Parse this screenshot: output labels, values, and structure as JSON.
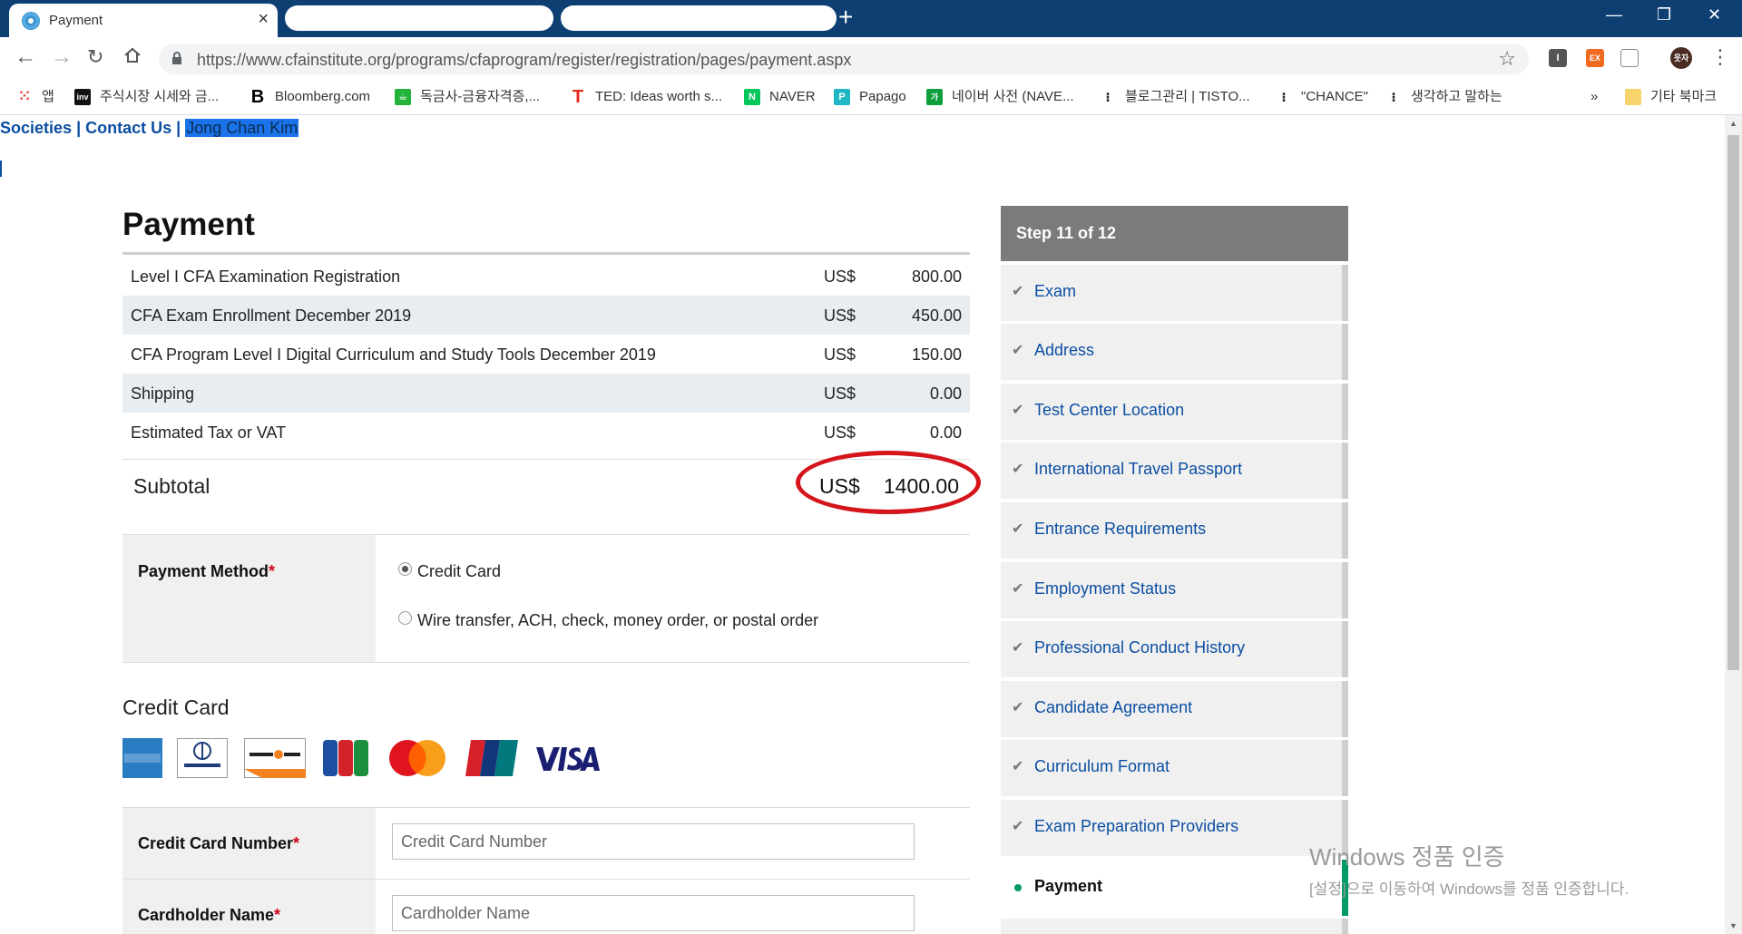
{
  "browser": {
    "tab_title": "Payment",
    "tab_close": "×",
    "new_tab": "+",
    "window_controls": {
      "minimize": "—",
      "restore": "❐",
      "close": "✕"
    },
    "url": "https://www.cfainstitute.org/programs/cfaprogram/register/registration/pages/payment.aspx",
    "profile_label": "웃자"
  },
  "bookmarks": {
    "items": [
      {
        "label": "앱",
        "icon": "apps-grid-icon"
      },
      {
        "label": "주식시장 시세와 금...",
        "icon": "investing-icon"
      },
      {
        "label": "Bloomberg.com",
        "icon": "bloomberg-icon"
      },
      {
        "label": "독금사-금융자격증,...",
        "icon": "naver-cafe-icon"
      },
      {
        "label": "TED: Ideas worth s...",
        "icon": "ted-icon"
      },
      {
        "label": "NAVER",
        "icon": "naver-icon"
      },
      {
        "label": "Papago",
        "icon": "papago-icon"
      },
      {
        "label": "네이버 사전 (NAVE...",
        "icon": "naver-dictionary-icon"
      },
      {
        "label": "블로그관리 | TISTO...",
        "icon": "tistory-icon"
      },
      {
        "label": "\"CHANCE\"",
        "icon": "tistory-icon"
      },
      {
        "label": "생각하고 말하는",
        "icon": "tistory-icon"
      }
    ],
    "overflow": "»",
    "other_bookmarks": "기타 북마크"
  },
  "topnav": {
    "societies": "Societies",
    "separator": "|",
    "contact": "Contact Us",
    "user": "Jong Chan Kim"
  },
  "payment": {
    "title": "Payment",
    "fees": [
      {
        "description": "Level I CFA Examination Registration",
        "currency": "US$",
        "amount": "800.00"
      },
      {
        "description": "CFA Exam Enrollment December 2019",
        "currency": "US$",
        "amount": "450.00"
      },
      {
        "description": "CFA Program Level I Digital Curriculum and Study Tools December 2019",
        "currency": "US$",
        "amount": "150.00"
      },
      {
        "description": "Shipping",
        "currency": "US$",
        "amount": "0.00"
      },
      {
        "description": "Estimated Tax or VAT",
        "currency": "US$",
        "amount": "0.00"
      }
    ],
    "subtotal": {
      "label": "Subtotal",
      "currency": "US$",
      "amount": "1400.00"
    },
    "method": {
      "label": "Payment Method",
      "required_mark": "*",
      "options": [
        {
          "label": "Credit Card",
          "selected": true
        },
        {
          "label": "Wire transfer, ACH, check, money order, or postal order",
          "selected": false
        }
      ]
    },
    "credit_card": {
      "heading": "Credit Card",
      "brands": [
        "AMERICAN EXPRESS",
        "Diners Club",
        "DISCOVER",
        "JCB",
        "MasterCard",
        "UnionPay",
        "VISA"
      ],
      "number_label": "Credit Card Number",
      "number_placeholder": "Credit Card Number",
      "name_label": "Cardholder Name",
      "name_placeholder": "Cardholder Name"
    }
  },
  "steps": {
    "header": "Step 11 of 12",
    "items": [
      {
        "label": "Exam",
        "status": "done"
      },
      {
        "label": "Address",
        "status": "done"
      },
      {
        "label": "Test Center Location",
        "status": "done"
      },
      {
        "label": "International Travel Passport",
        "status": "done"
      },
      {
        "label": "Entrance Requirements",
        "status": "done"
      },
      {
        "label": "Employment Status",
        "status": "done"
      },
      {
        "label": "Professional Conduct History",
        "status": "done"
      },
      {
        "label": "Candidate Agreement",
        "status": "done"
      },
      {
        "label": "Curriculum Format",
        "status": "done"
      },
      {
        "label": "Exam Preparation Providers",
        "status": "done"
      },
      {
        "label": "Payment",
        "status": "current"
      }
    ],
    "check_glyph": "✔"
  },
  "watermark": {
    "line1": "Windows 정품 인증",
    "line2": "[설정]으로 이동하여 Windows를 정품 인증합니다."
  },
  "colors": {
    "tabstrip": "#0d3f73",
    "link": "#0b4ea2",
    "accent_green": "#009a66",
    "annotation_red": "#d4151b",
    "required": "#d0021b"
  }
}
